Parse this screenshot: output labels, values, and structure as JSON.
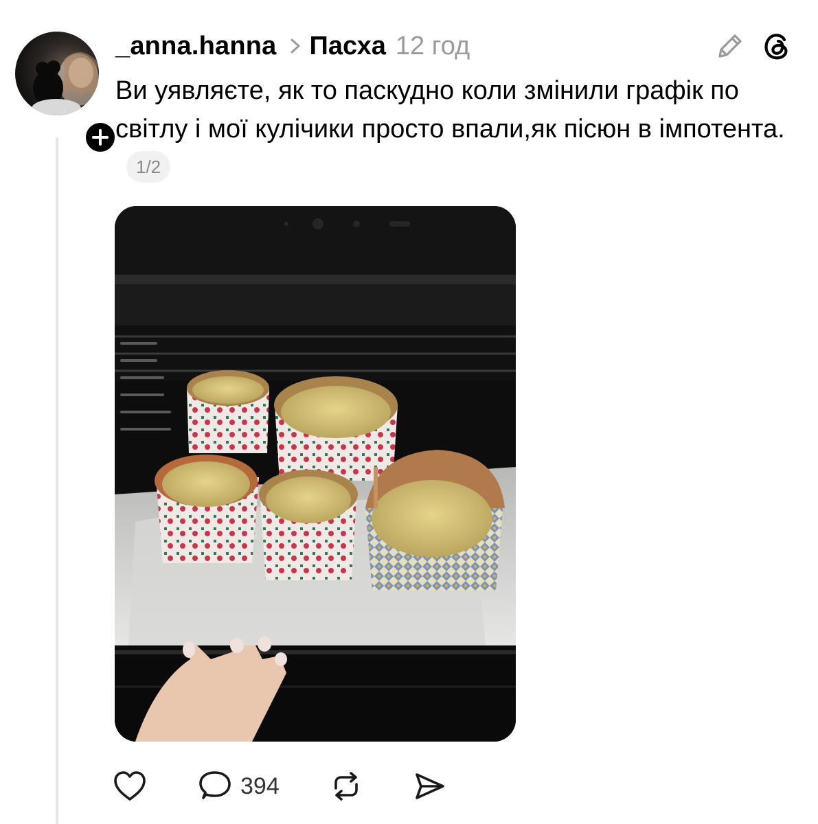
{
  "post": {
    "username": "_anna.hanna",
    "topic": "Пасха",
    "time": "12 год",
    "text": "Ви уявляєте, як то паскудно коли змінили графік по світлу і мої кулічики просто впали,як пісюн в імпотента.",
    "page_indicator": "1/2",
    "image_alt": "Kulich Easter breads in paper molds inside an oven"
  },
  "actions": {
    "like_icon": "heart-icon",
    "reply_icon": "comment-icon",
    "reply_count": "394",
    "repost_icon": "repost-icon",
    "share_icon": "send-icon"
  },
  "header_icons": {
    "edit_icon": "pencil-icon",
    "app_icon": "threads-logo-icon"
  },
  "avatar": {
    "badge_icon": "plus-icon"
  }
}
